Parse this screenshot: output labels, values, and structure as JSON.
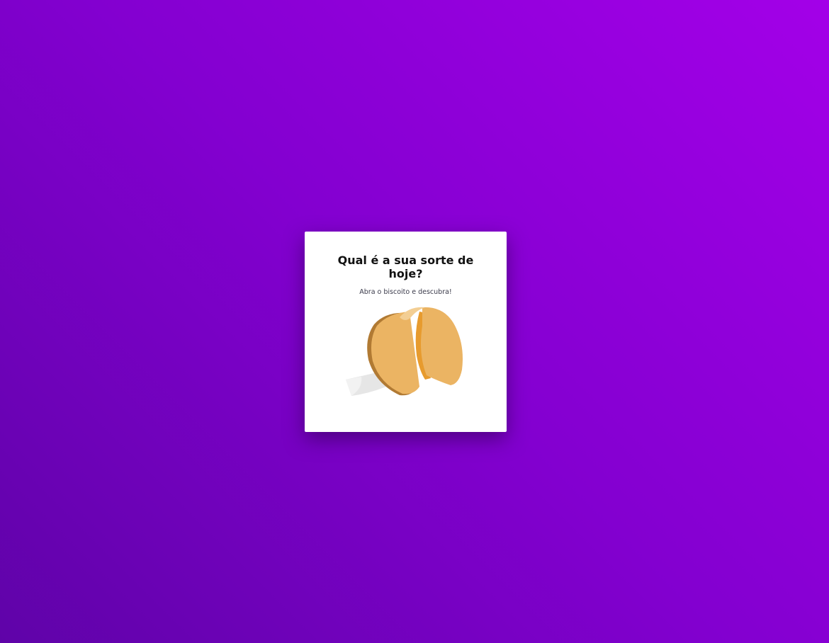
{
  "card": {
    "title": "Qual é a sua sorte de hoje?",
    "subtitle": "Abra o biscoito e descubra!",
    "cookie_icon": "fortune-cookie-icon"
  },
  "colors": {
    "background_start": "#5f03a8",
    "background_end": "#a300e8",
    "card": "#ffffff",
    "cookie": "#ebb463",
    "cookie_inner": "#e79b2e",
    "cookie_shadow": "#b17a33",
    "paper": "#e4e4e4"
  }
}
